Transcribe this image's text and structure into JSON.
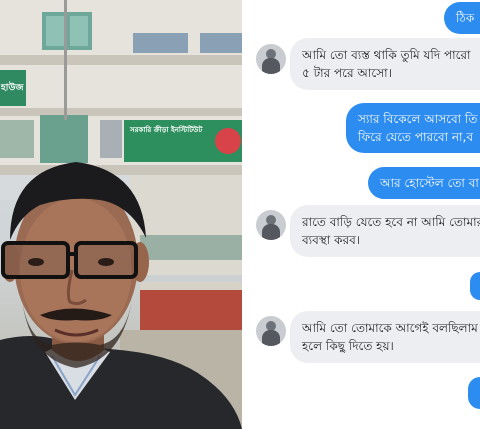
{
  "photo": {
    "sign_left": "হাউজ",
    "sign_right": "সরকারি ক্রীড়া ইনস্টিটিউট"
  },
  "chat": {
    "messages": [
      {
        "from": "sent",
        "lines": [
          "ঠিক"
        ]
      },
      {
        "from": "received",
        "lines": [
          "আমি তো ব্যস্ত থাকি তুমি যদি পারো",
          "৫ টার পরে আসো।"
        ]
      },
      {
        "from": "sent",
        "lines": [
          "স্যার বিকেলে আসবো তি",
          "ফিরে যেতে পারবো না,ব"
        ]
      },
      {
        "from": "sent",
        "lines": [
          "আর হোস্টেল তো বা"
        ]
      },
      {
        "from": "received",
        "lines": [
          "রাতে বাড়ি যেতে হবে না আমি তোমার",
          "ব্যবস্থা করব।"
        ]
      },
      {
        "from": "sent",
        "lines": [
          ""
        ]
      },
      {
        "from": "received",
        "lines": [
          "আমি তো তোমাকে আগেই বলছিলাম",
          "হলে কিছু দিতে হয়।"
        ]
      },
      {
        "from": "sent",
        "lines": [
          ""
        ]
      }
    ]
  }
}
